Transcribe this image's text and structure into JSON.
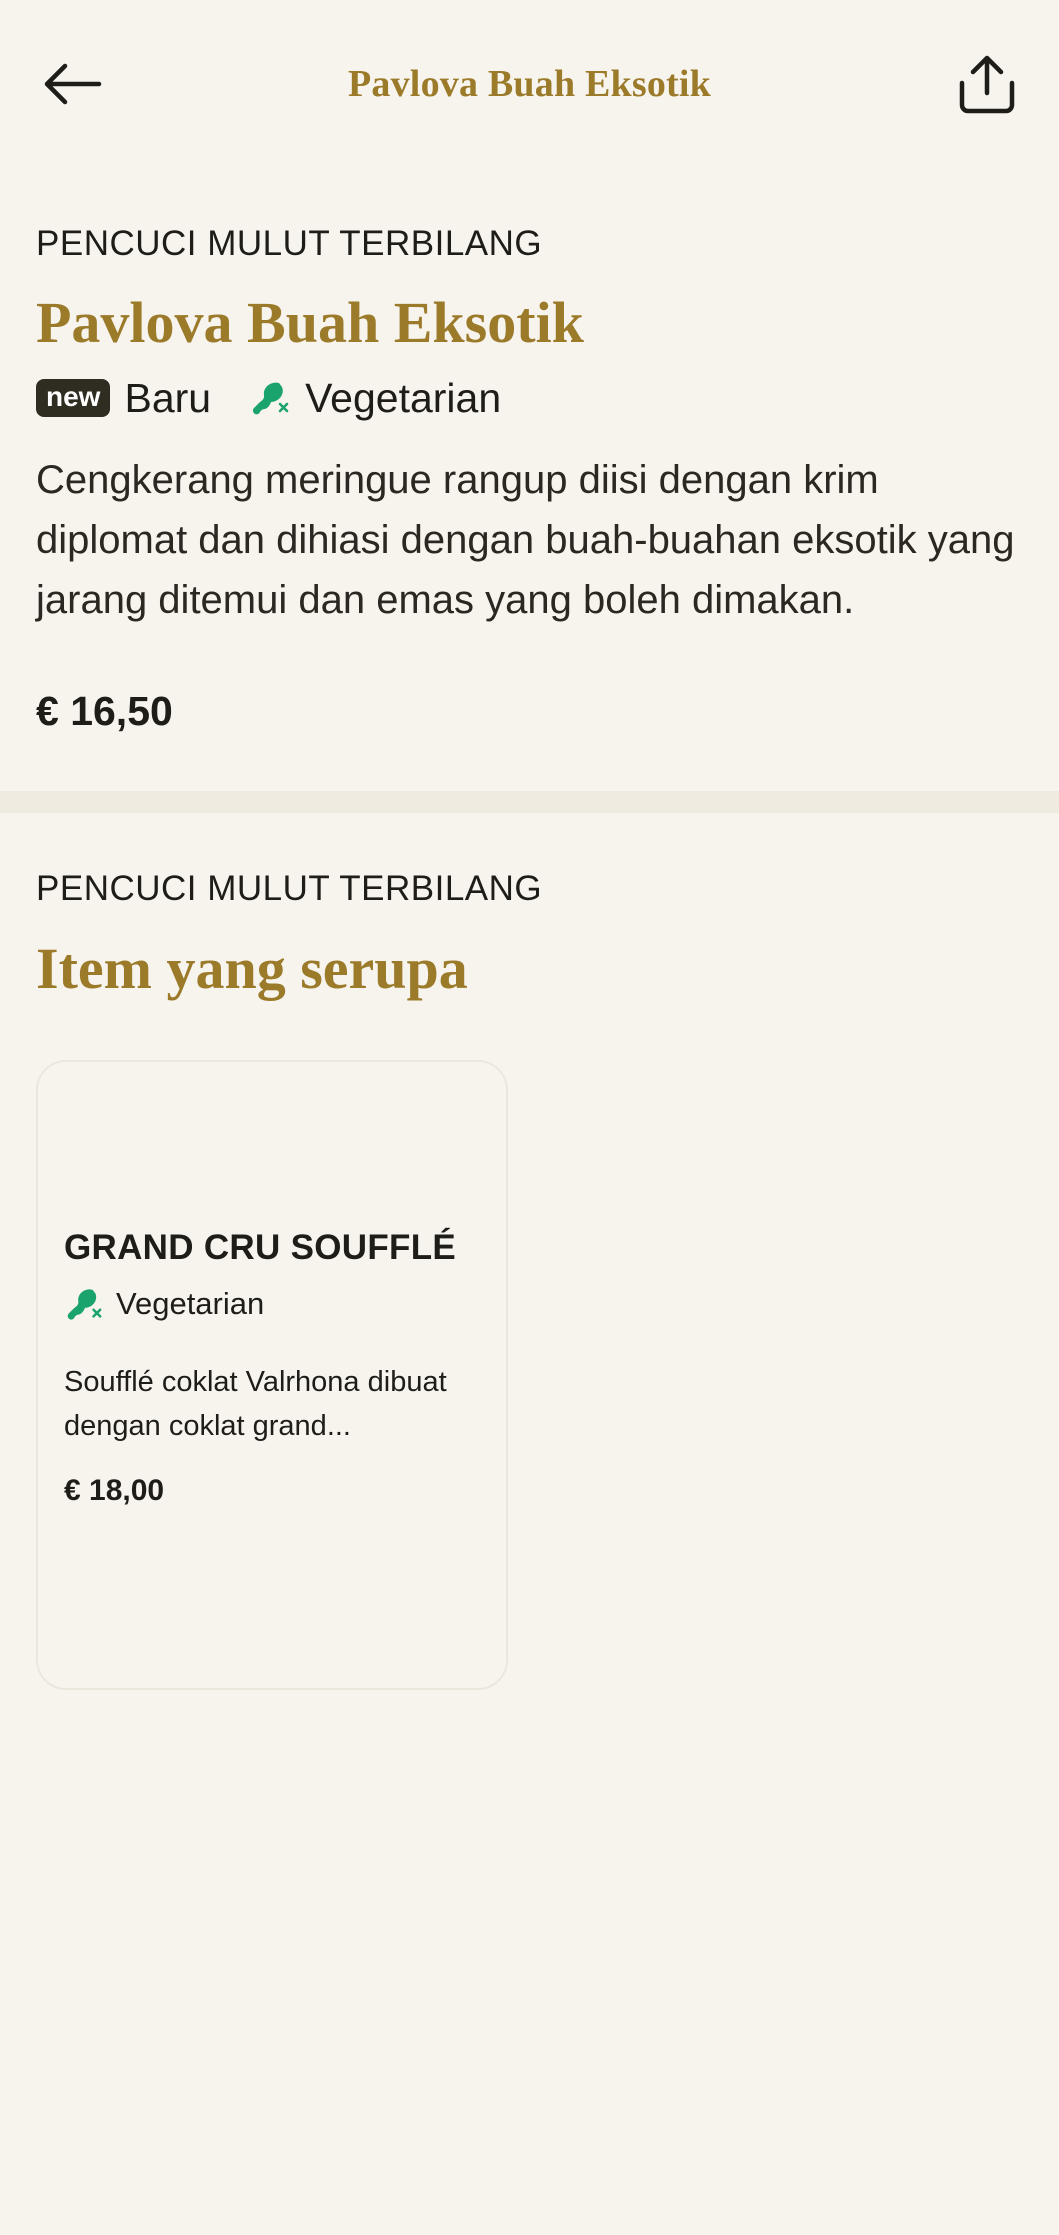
{
  "header": {
    "title": "Pavlova Buah Eksotik",
    "back_icon": "arrow-left-icon",
    "share_icon": "share-icon"
  },
  "product": {
    "category": "PENCUCI MULUT TERBILANG",
    "name": "Pavlova Buah Eksotik",
    "badge_new": "new",
    "tag_new": "Baru",
    "tag_veg": "Vegetarian",
    "description": "Cengkerang meringue rangup diisi dengan krim diplomat dan dihiasi dengan buah-buahan eksotik yang jarang ditemui dan emas yang boleh dimakan.",
    "price": "€ 16,50"
  },
  "similar": {
    "category": "PENCUCI MULUT TERBILANG",
    "title": "Item yang serupa",
    "items": [
      {
        "name": "GRAND CRU SOUFFLÉ",
        "tag": "Vegetarian",
        "description": "Soufflé coklat Valrhona dibuat dengan coklat grand...",
        "price": "€ 18,00"
      }
    ]
  },
  "colors": {
    "background": "#f7f4ee",
    "accent_gold": "#9b7a2a",
    "veg_green": "#1aa36b",
    "badge_dark": "#2f2c22"
  }
}
